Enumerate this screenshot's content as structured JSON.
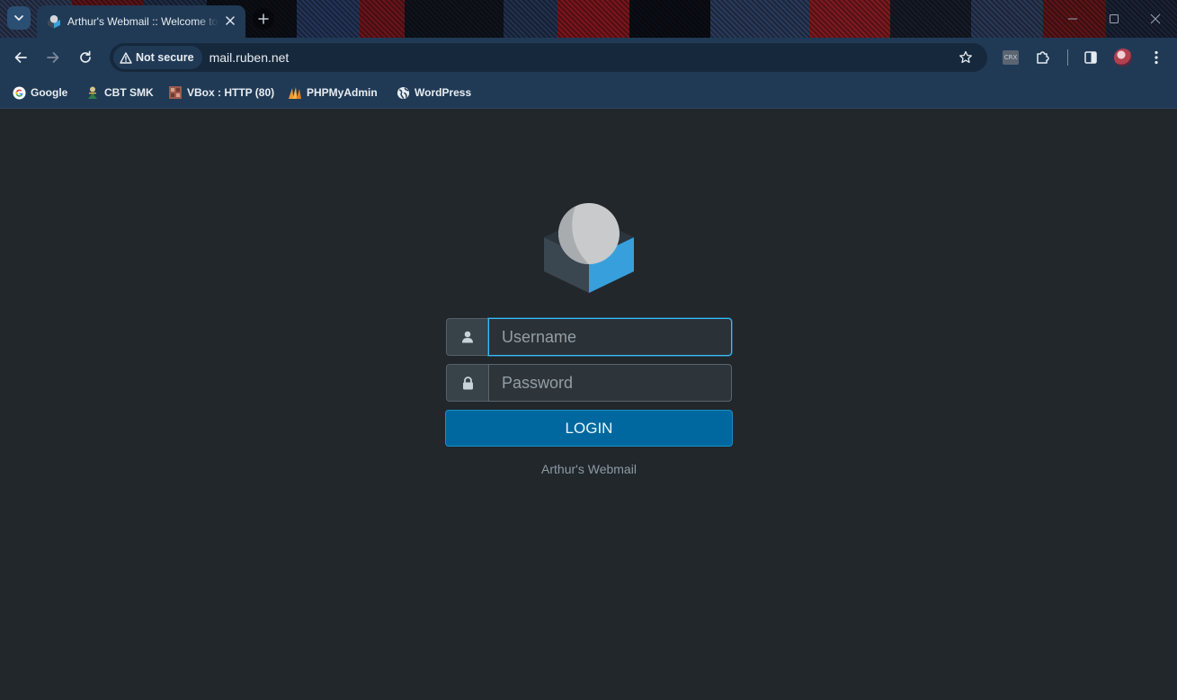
{
  "browser": {
    "tab": {
      "title": "Arthur's Webmail :: Welcome to Arthur's Webmail"
    },
    "omnibox": {
      "security_label": "Not secure",
      "url": "mail.ruben.net",
      "ext_label": "CRX"
    },
    "bookmarks": [
      {
        "label": "Google",
        "icon": "google-icon"
      },
      {
        "label": "CBT SMK",
        "icon": "cbt-smk-icon"
      },
      {
        "label": "VBox : HTTP (80)",
        "icon": "vbox-icon"
      },
      {
        "label": "PHPMyAdmin",
        "icon": "phpmyadmin-icon"
      },
      {
        "label": "WordPress",
        "icon": "globe-icon"
      }
    ]
  },
  "login": {
    "username_placeholder": "Username",
    "password_placeholder": "Password",
    "button_label": "LOGIN",
    "footer": "Arthur's Webmail"
  },
  "colors": {
    "page_background": "#21272b",
    "accent": "#00689e",
    "focus_border": "#37beff",
    "browser_chrome": "#203a55"
  }
}
